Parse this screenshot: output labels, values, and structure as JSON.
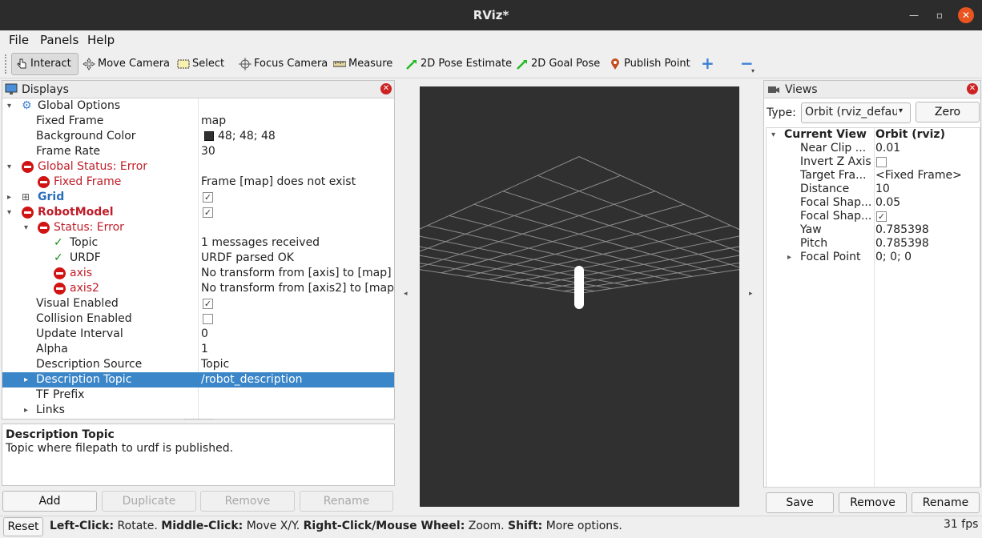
{
  "window": {
    "title": "RViz*"
  },
  "menus": [
    "File",
    "Panels",
    "Help"
  ],
  "toolbar": {
    "tools": [
      {
        "label": "Interact",
        "icon": "hand-pointer-icon",
        "active": true
      },
      {
        "label": "Move Camera",
        "icon": "move-camera-icon"
      },
      {
        "label": "Select",
        "icon": "select-rect-icon"
      },
      {
        "label": "Focus Camera",
        "icon": "focus-camera-icon"
      },
      {
        "label": "Measure",
        "icon": "ruler-icon"
      },
      {
        "label": "2D Pose Estimate",
        "icon": "green-arrow-icon"
      },
      {
        "label": "2D Goal Pose",
        "icon": "green-arrow-icon"
      },
      {
        "label": "Publish Point",
        "icon": "map-pin-icon"
      }
    ],
    "add_icon": "plus-icon",
    "remove_icon": "minus-icon"
  },
  "displays": {
    "title": "Displays",
    "rows": [
      {
        "label": "Global Options",
        "value": ""
      },
      {
        "label": "Fixed Frame",
        "value": "map"
      },
      {
        "label": "Background Color",
        "value": "48; 48; 48"
      },
      {
        "label": "Frame Rate",
        "value": "30"
      },
      {
        "label": "Global Status: Error",
        "value": ""
      },
      {
        "label": "Fixed Frame",
        "value": "Frame [map] does not exist"
      },
      {
        "label": "Grid",
        "value": ""
      },
      {
        "label": "RobotModel",
        "value": ""
      },
      {
        "label": "Status: Error",
        "value": ""
      },
      {
        "label": "Topic",
        "value": "1 messages received"
      },
      {
        "label": "URDF",
        "value": "URDF parsed OK"
      },
      {
        "label": "axis",
        "value": "No transform from [axis] to [map]"
      },
      {
        "label": "axis2",
        "value": "No transform from [axis2] to [map]"
      },
      {
        "label": "Visual Enabled",
        "value": ""
      },
      {
        "label": "Collision Enabled",
        "value": ""
      },
      {
        "label": "Update Interval",
        "value": "0"
      },
      {
        "label": "Alpha",
        "value": "1"
      },
      {
        "label": "Description Source",
        "value": "Topic"
      },
      {
        "label": "Description Topic",
        "value": "/robot_description"
      },
      {
        "label": "TF Prefix",
        "value": ""
      },
      {
        "label": "Links",
        "value": ""
      }
    ],
    "checkboxes": {
      "grid": true,
      "robot_model": true,
      "visual_enabled": true,
      "collision_enabled": false
    },
    "background_color": "#303030",
    "description": {
      "title": "Description Topic",
      "text": "Topic where filepath to urdf is published."
    },
    "buttons": {
      "add": "Add",
      "duplicate": "Duplicate",
      "remove": "Remove",
      "rename": "Rename"
    }
  },
  "views": {
    "title": "Views",
    "type_label": "Type:",
    "type_value": "Orbit (rviz_defau",
    "zero_label": "Zero",
    "rows": [
      {
        "label": "Current View",
        "value": "Orbit (rviz)"
      },
      {
        "label": "Near Clip ...",
        "value": "0.01"
      },
      {
        "label": "Invert Z Axis",
        "value": ""
      },
      {
        "label": "Target Fra...",
        "value": "<Fixed Frame>"
      },
      {
        "label": "Distance",
        "value": "10"
      },
      {
        "label": "Focal Shap...",
        "value": "0.05"
      },
      {
        "label": "Focal Shap...",
        "value": ""
      },
      {
        "label": "Yaw",
        "value": "0.785398"
      },
      {
        "label": "Pitch",
        "value": "0.785398"
      },
      {
        "label": "Focal Point",
        "value": "0; 0; 0"
      }
    ],
    "checkboxes": {
      "invert_z": false,
      "focal_shape_fixed": true
    },
    "buttons": {
      "save": "Save",
      "remove": "Remove",
      "rename": "Rename"
    }
  },
  "statusbar": {
    "reset": "Reset",
    "hint_parts": [
      {
        "text": "Left-Click:",
        "bold": true
      },
      {
        "text": " Rotate. ",
        "bold": false
      },
      {
        "text": "Middle-Click:",
        "bold": true
      },
      {
        "text": " Move X/Y. ",
        "bold": false
      },
      {
        "text": "Right-Click/Mouse Wheel:",
        "bold": true
      },
      {
        "text": " Zoom. ",
        "bold": false
      },
      {
        "text": "Shift:",
        "bold": true
      },
      {
        "text": " More options.",
        "bold": false
      }
    ],
    "fps": "31 fps"
  },
  "colors": {
    "selection": "#3a86c8",
    "error": "#c01c28",
    "accent": "#e95420"
  }
}
